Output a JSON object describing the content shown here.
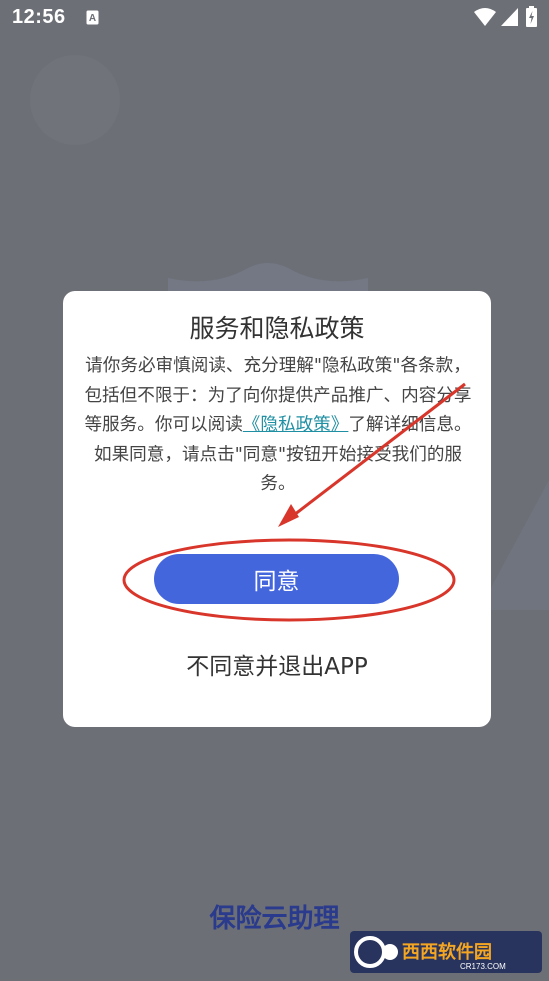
{
  "status_bar": {
    "time": "12:56",
    "keyboard_indicator": "A"
  },
  "dialog": {
    "title": "服务和隐私政策",
    "body_prefix": "请你务必审慎阅读、充分理解\"隐私政策\"各条款，包括但不限于：为了向你提供产品推广、内容分享等服务。你可以阅读",
    "policy_link": "《隐私政策》",
    "body_suffix": "了解详细信息。如果同意，请点击\"同意\"按钮开始接受我们的服务。",
    "agree_label": "同意",
    "decline_label": "不同意并退出APP"
  },
  "app_name": "保险云助理",
  "watermark": {
    "brand": "西西软件园",
    "url": "CR173.COM"
  },
  "colors": {
    "overlay": "#6c6f76",
    "agree_button": "#4466dd",
    "link": "#1f8fa3",
    "annotation": "#d9362b",
    "app_name": "#2a3a8c"
  },
  "icons": [
    "keyboard-a-icon",
    "wifi-icon",
    "signal-icon",
    "battery-charging-icon"
  ]
}
